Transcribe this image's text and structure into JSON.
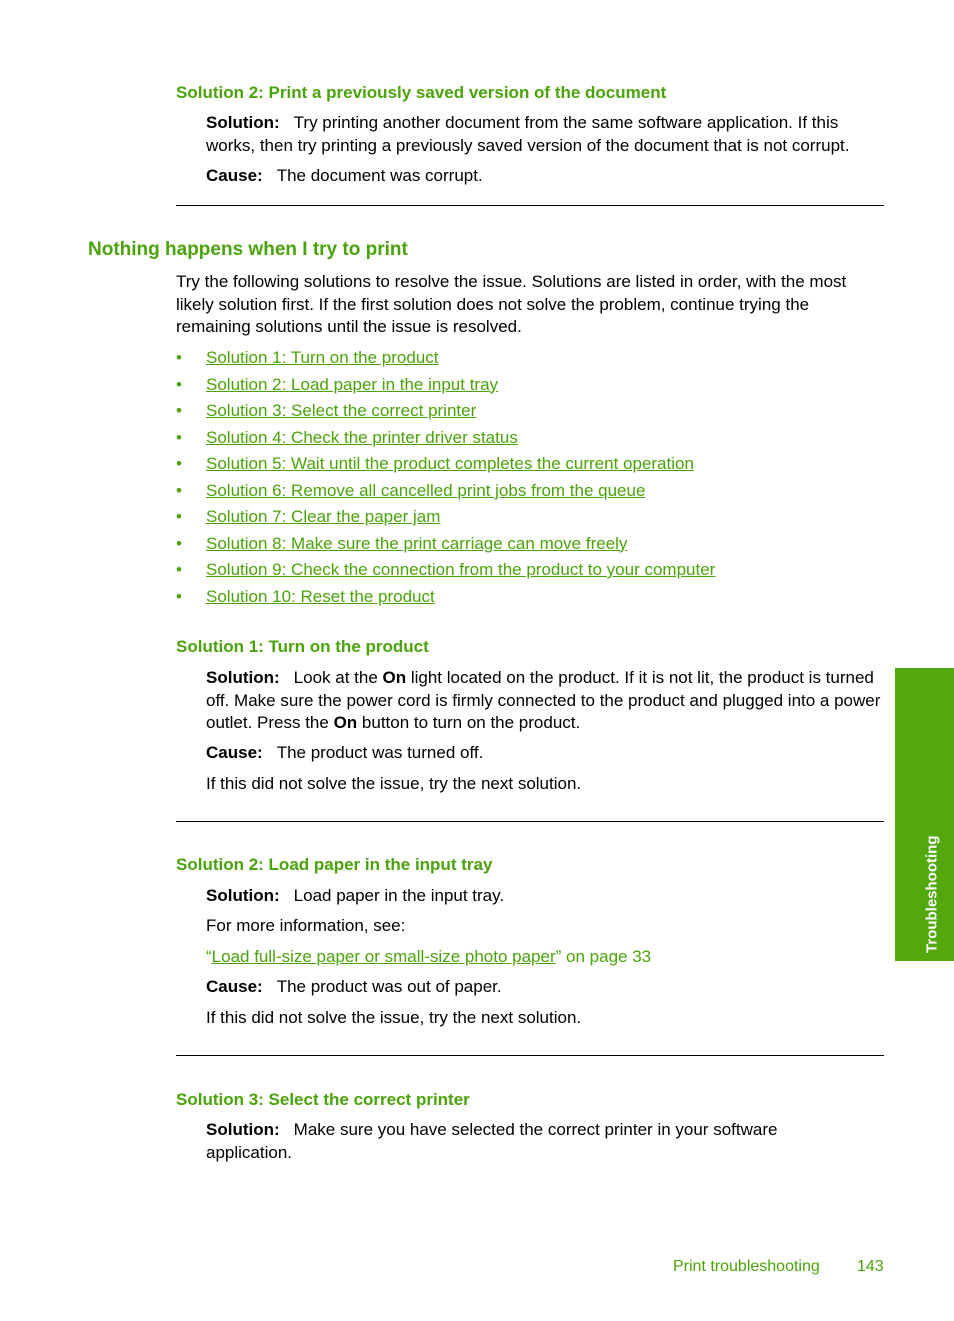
{
  "prev_section": {
    "heading": "Solution 2: Print a previously saved version of the document",
    "solution_label": "Solution:",
    "solution_text": "Try printing another document from the same software application. If this works, then try printing a previously saved version of the document that is not corrupt.",
    "cause_label": "Cause:",
    "cause_text": "The document was corrupt."
  },
  "section": {
    "title": "Nothing happens when I try to print",
    "intro": "Try the following solutions to resolve the issue. Solutions are listed in order, with the most likely solution first. If the first solution does not solve the problem, continue trying the remaining solutions until the issue is resolved.",
    "bullet": "•",
    "links": [
      "Solution 1: Turn on the product",
      "Solution 2: Load paper in the input tray",
      "Solution 3: Select the correct printer",
      "Solution 4: Check the printer driver status",
      "Solution 5: Wait until the product completes the current operation",
      "Solution 6: Remove all cancelled print jobs from the queue",
      "Solution 7: Clear the paper jam",
      "Solution 8: Make sure the print carriage can move freely",
      "Solution 9: Check the connection from the product to your computer",
      "Solution 10: Reset the product"
    ]
  },
  "sol1": {
    "heading": "Solution 1: Turn on the product",
    "solution_label": "Solution:",
    "text_a": "Look at the ",
    "bold_a": "On",
    "text_b": " light located on the product. If it is not lit, the product is turned off. Make sure the power cord is firmly connected to the product and plugged into a power outlet. Press the ",
    "bold_b": "On",
    "text_c": " button to turn on the product.",
    "cause_label": "Cause:",
    "cause_text": "The product was turned off.",
    "next": "If this did not solve the issue, try the next solution."
  },
  "sol2": {
    "heading": "Solution 2: Load paper in the input tray",
    "solution_label": "Solution:",
    "solution_text": "Load paper in the input tray.",
    "more_info": "For more information, see:",
    "ref_open_quote": "“",
    "ref_link": "Load full-size paper or small-size photo paper",
    "ref_suffix": "” on page 33",
    "cause_label": "Cause:",
    "cause_text": "The product was out of paper.",
    "next": "If this did not solve the issue, try the next solution."
  },
  "sol3": {
    "heading": "Solution 3: Select the correct printer",
    "solution_label": "Solution:",
    "solution_text": "Make sure you have selected the correct printer in your software application."
  },
  "side_tab": {
    "label": "Troubleshooting",
    "color": "#52a80c"
  },
  "footer": {
    "chapter": "Print troubleshooting",
    "page": "143"
  },
  "colors": {
    "accent": "#4aa30a",
    "text": "#000000"
  }
}
